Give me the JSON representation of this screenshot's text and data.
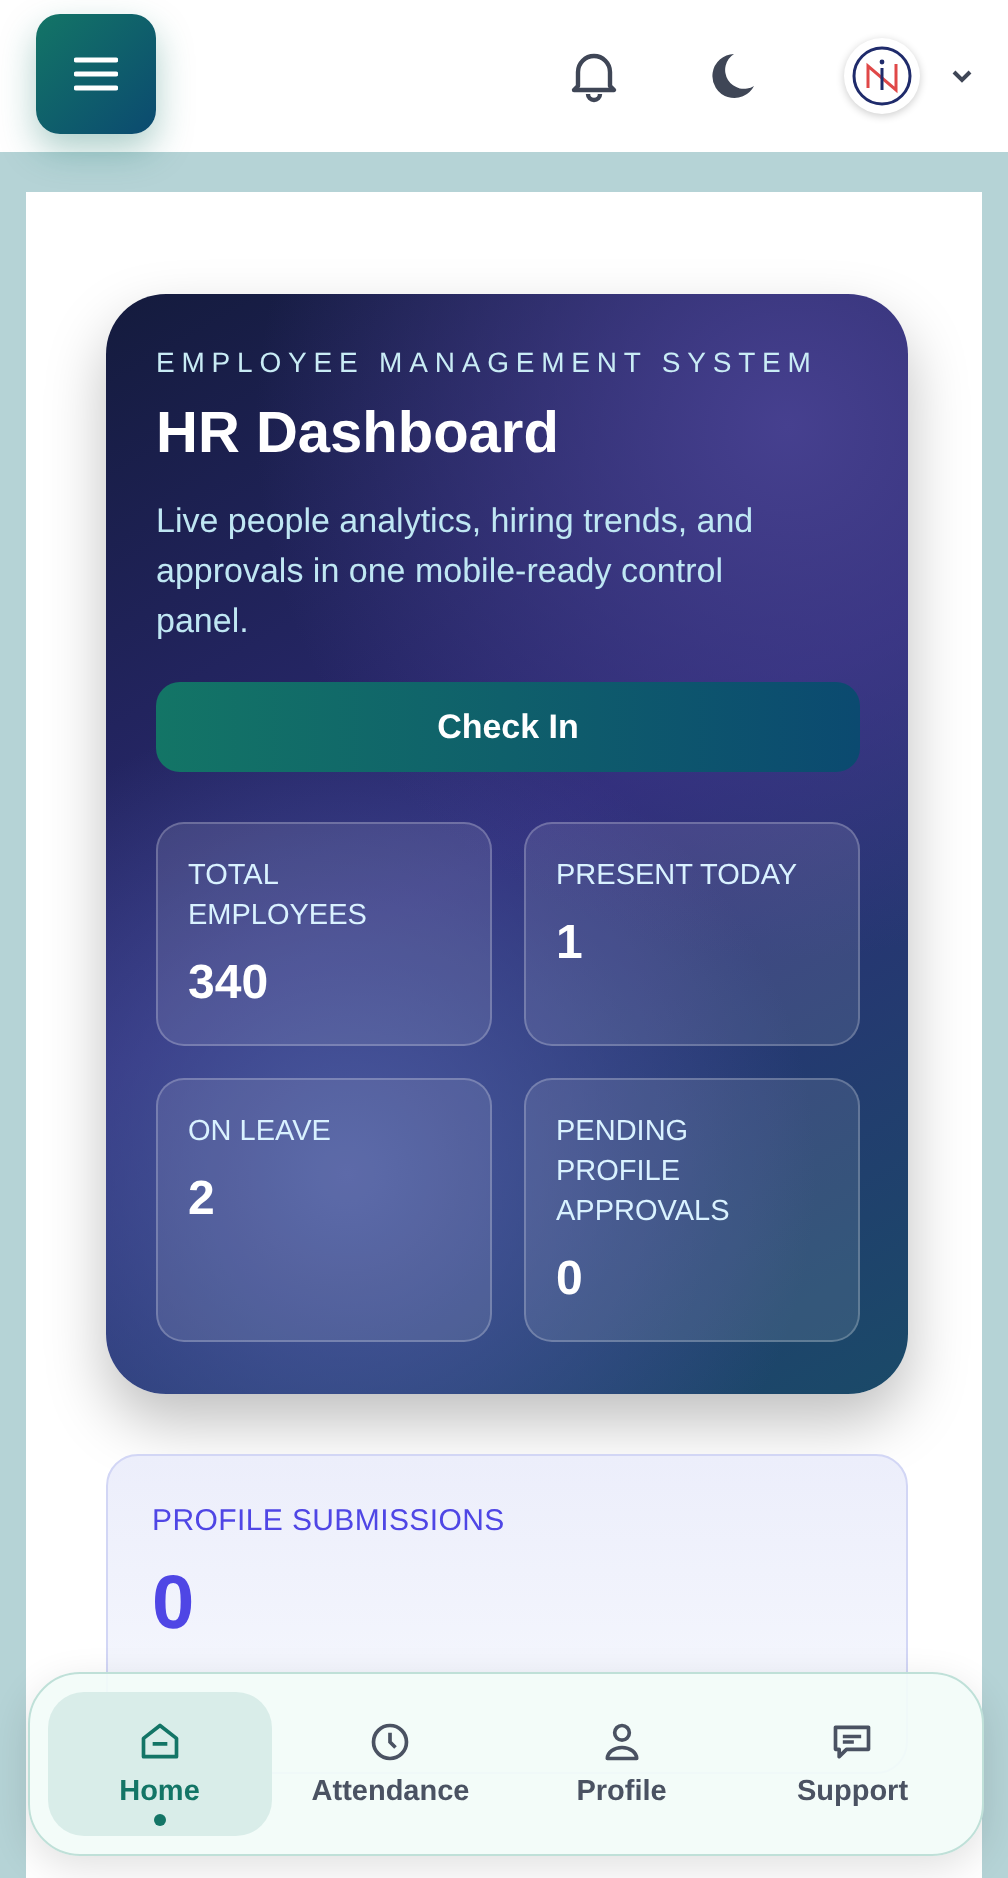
{
  "hero": {
    "eyebrow": "EMPLOYEE MANAGEMENT SYSTEM",
    "title": "HR Dashboard",
    "description": "Live people analytics, hiring trends, and approvals in one mobile-ready control panel.",
    "button": "Check In",
    "stats": [
      {
        "label": "TOTAL EMPLOYEES",
        "value": "340"
      },
      {
        "label": "PRESENT TODAY",
        "value": "1"
      },
      {
        "label": "ON LEAVE",
        "value": "2"
      },
      {
        "label": "PENDING PROFILE APPROVALS",
        "value": "0"
      }
    ]
  },
  "metrics": [
    {
      "label": "PROFILE SUBMISSIONS",
      "value": "0",
      "color": "#4f46e5"
    }
  ],
  "nav": [
    {
      "kind": "home",
      "label": "Home",
      "selected": true
    },
    {
      "kind": "clock",
      "label": "Attendance",
      "selected": false
    },
    {
      "kind": "person",
      "label": "Profile",
      "selected": false
    },
    {
      "kind": "chat",
      "label": "Support",
      "selected": false
    }
  ]
}
